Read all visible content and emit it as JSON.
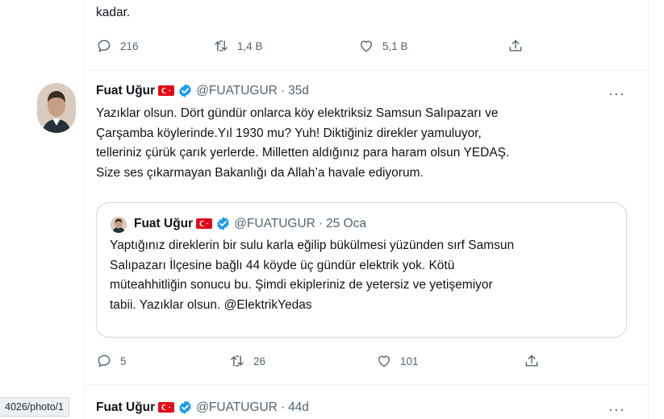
{
  "top_tweet": {
    "text_tail": "kadar.",
    "actions": {
      "replies": "216",
      "retweets": "1,4 B",
      "likes": "5,1 B"
    }
  },
  "main_tweet": {
    "author_name": "Fuat Uğur",
    "handle": "@FUATUGUR",
    "separator": "·",
    "time": "35d",
    "text": [
      "Yazıklar olsun. Dört gündür onlarca köy elektriksiz Samsun Salıpazarı ve",
      "Çarşamba köylerinde.Yıl 1930 mu? Yuh! Diktiğiniz direkler yamuluyor,",
      "telleriniz çürük çarık yerlerde. Milletten aldığınız para haram olsun YEDAŞ.",
      "Size ses çıkarmayan Bakanlığı da Allah’a havale ediyorum."
    ],
    "more": "···",
    "quoted": {
      "author_name": "Fuat Uğur",
      "handle": "@FUATUGUR",
      "separator": "·",
      "time": "25 Oca",
      "text": [
        "Yaptığınız direklerin bir sulu karla eğilip bükülmesi yüzünden sırf Samsun",
        "Salıpazarı İlçesine bağlı 44 köyde üç gündür elektrik yok. Kötü",
        "müteahhitliğin sonucu bu. Şimdi ekipleriniz de yetersiz ve yetişemiyor",
        "tabii. Yazıklar olsun. @ElektrikYedas"
      ]
    },
    "actions": {
      "replies": "5",
      "retweets": "26",
      "likes": "101"
    }
  },
  "next_tweet": {
    "author_name": "Fuat Uğur",
    "handle": "@FUATUGUR",
    "separator": "·",
    "time": "44d",
    "more": "···"
  },
  "status_url": "4026/photo/1",
  "icons": {
    "reply": "reply-icon",
    "retweet": "retweet-icon",
    "like": "heart-icon",
    "share": "share-icon",
    "verified": "verified-badge-icon",
    "flag": "turkey-flag-icon",
    "more": "more-options-icon"
  },
  "colors": {
    "verified": "#1d9bf0",
    "flag": "#e30a17",
    "muted": "#536471",
    "border": "#cfd9de"
  }
}
